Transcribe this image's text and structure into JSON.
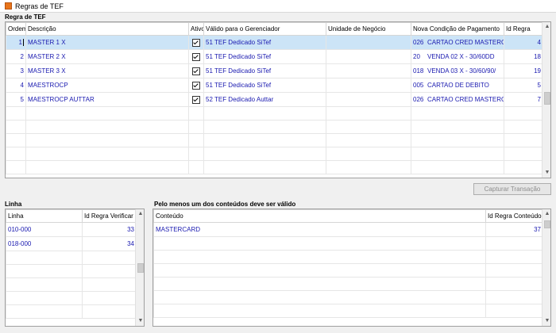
{
  "window": {
    "title": "Regras de TEF"
  },
  "regra": {
    "section_title": "Regra de TEF",
    "columns": [
      "Ordem",
      "Descrição",
      "Ativo",
      "Válido para o Gerenciador",
      "Unidade de Negócio",
      "Nova Condição de Pagamento",
      "Id Regra"
    ],
    "rows": [
      {
        "ordem": "1",
        "descricao": "MASTER 1 X",
        "ativo": true,
        "gerenciador": "51 TEF Dedicado SiTef",
        "unidade": "",
        "cond_cod": "026",
        "cond_desc": "CARTAO CRED MASTERCARD",
        "id": "4"
      },
      {
        "ordem": "2",
        "descricao": "MASTER 2 X",
        "ativo": true,
        "gerenciador": "51 TEF Dedicado SiTef",
        "unidade": "",
        "cond_cod": "20",
        "cond_desc": "VENDA 02 X - 30/60DD",
        "id": "18"
      },
      {
        "ordem": "3",
        "descricao": "MASTER 3 X",
        "ativo": true,
        "gerenciador": "51 TEF Dedicado SiTef",
        "unidade": "",
        "cond_cod": "018",
        "cond_desc": "VENDA 03 X - 30/60/90/",
        "id": "19"
      },
      {
        "ordem": "4",
        "descricao": "MAESTROCP",
        "ativo": true,
        "gerenciador": "51 TEF Dedicado SiTef",
        "unidade": "",
        "cond_cod": "005",
        "cond_desc": "CARTAO DE DEBITO",
        "id": "5"
      },
      {
        "ordem": "5",
        "descricao": "MAESTROCP AUTTAR",
        "ativo": true,
        "gerenciador": "52 TEF Dedicado Auttar",
        "unidade": "",
        "cond_cod": "026",
        "cond_desc": "CARTAO CRED MASTERCARD",
        "id": "7"
      }
    ],
    "capture_button": "Capturar Transação"
  },
  "linha": {
    "section_title": "Linha",
    "columns": [
      "Linha",
      "Id Regra Verificar"
    ],
    "rows": [
      {
        "linha": "010-000",
        "id": "33"
      },
      {
        "linha": "018-000",
        "id": "34"
      }
    ]
  },
  "conteudos": {
    "section_title": "Pelo menos um dos conteúdos deve ser válido",
    "columns": [
      "Conteúdo",
      "Id Regra Conteúdo"
    ],
    "rows": [
      {
        "conteudo": "MASTERCARD",
        "id": "37"
      }
    ]
  },
  "colors": {
    "selected_row": "#cce4f7",
    "cell_text": "#1a1ab0",
    "app_icon": "#e8741a"
  }
}
